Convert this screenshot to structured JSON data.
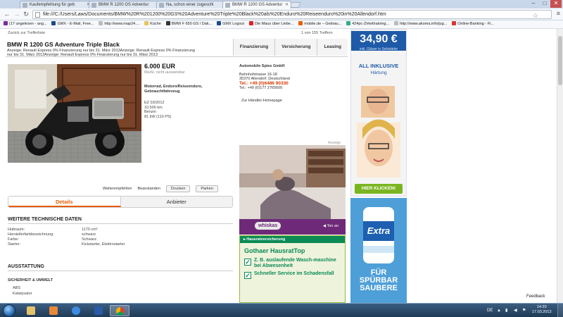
{
  "browser": {
    "tabs": [
      {
        "label": "Kaufempfehlung für geb"
      },
      {
        "label": "BMW R 1200 GS Adventur"
      },
      {
        "label": "Na, schon einer zugeschl"
      },
      {
        "label": "BMW R 1200 GS Adventur"
      }
    ],
    "url": "file:///C:/Users/Laws/Documents/BMW%20R%201200%20GS%20Adventure%20Triple%20Black%20als%20Enduro%20Reiseenduro%20in%20Allendorf.htm",
    "bookmarks": [
      "(17 ungelesen - ang...",
      "GMX - E-Mail, Free...",
      "http://www.map24....",
      "Küche",
      "BMW F 650 GS / Dak...",
      "GMX Logout",
      "Die Maus über Liebe...",
      "mobile.de – Gebrau...",
      "424pc-Zirkeltraining...",
      "http://www.akoma.info/jug...",
      "Online-Banking - Fi..."
    ]
  },
  "page": {
    "breadcrumb": "Zurück zur Trefferliste",
    "pager": "1 von 155 Treffern",
    "title": "BMW R 1200 GS Adventure Triple Black",
    "finance_lines": [
      "Anzeige:      Renault Express 0% Finanzierung nur bis 31. März 2013Anzeige:      Renault Express 0% Finanzierung",
      "nur bis 31. März 2013Anzeige:      Renault Express 0% Finanzierung nur bis 31. März 2013"
    ],
    "action_tabs": [
      "Finanzierung",
      "Versicherung",
      "Leasing"
    ],
    "price": "6.000 EUR",
    "vat": "MwSt. nicht ausweisbar",
    "category": "Motorrad, Enduro/Reiseenduro, Gebrauchtfahrzeug",
    "specs": [
      "EZ 03/2012",
      "10.500 km",
      "Benzin",
      "81 kW (110 PS)"
    ],
    "dealer": {
      "name": "Automobile Spies GmbH",
      "street": "Bahnhofstrasse 16-18",
      "city": "35370 Allendorf, Deutschland",
      "phone": "Tel.: +49 (0)6486 90330",
      "mobile": "Tel.: +49 (0)177 2765600",
      "homepage": "Zur Händler-Homepage"
    },
    "small_actions": {
      "recommend": "Weiterempfehlen",
      "complain": "Beanstanden",
      "print": "Drucken",
      "park": "Parken"
    },
    "detail_tabs": [
      "Details",
      "Anbieter"
    ],
    "tech_heading": "WEITERE TECHNISCHE DATEN",
    "tech": [
      {
        "key": "Hubraum:",
        "value": "1170 cm³"
      },
      {
        "key": "Herstellerfarbbezeichnung:",
        "value": "schwarz"
      },
      {
        "key": "Farbe:",
        "value": "Schwarz"
      },
      {
        "key": "Starter:",
        "value": "Kickstarter, Elektrostarter"
      }
    ],
    "equip_heading": "AUSSTATTUNG",
    "equip_sub": "SICHERHEIT & UMWELT",
    "equip_items": [
      "ABS",
      "Katalysator"
    ],
    "feedback": "Feedback"
  },
  "ads": {
    "label": "Anzeige",
    "whiskas_logo": "whiskas",
    "whiskas_cta": "Ton an",
    "gothaer_header": "Hausratversicherung",
    "gothaer_title": "Gothaer HausratTop",
    "gothaer_items": [
      "Z. B. auslaufende Wasch-maschine bei Abwesenheit",
      "Schneller Service im Schadensfall"
    ],
    "side_price": "34,90 €",
    "side_price_sub": "inkl. Gläser in Sehstärke",
    "side_inclusive": "ALL INKLUSIVE",
    "side_haertung": "Härtung",
    "side_cta": "HIER KLICKEN!",
    "extra_lines": [
      "FÜR",
      "SPÜRBAR",
      "SAUBERE"
    ]
  },
  "taskbar": {
    "language": "DE",
    "time": "14:20",
    "date": "17.03.2013"
  }
}
